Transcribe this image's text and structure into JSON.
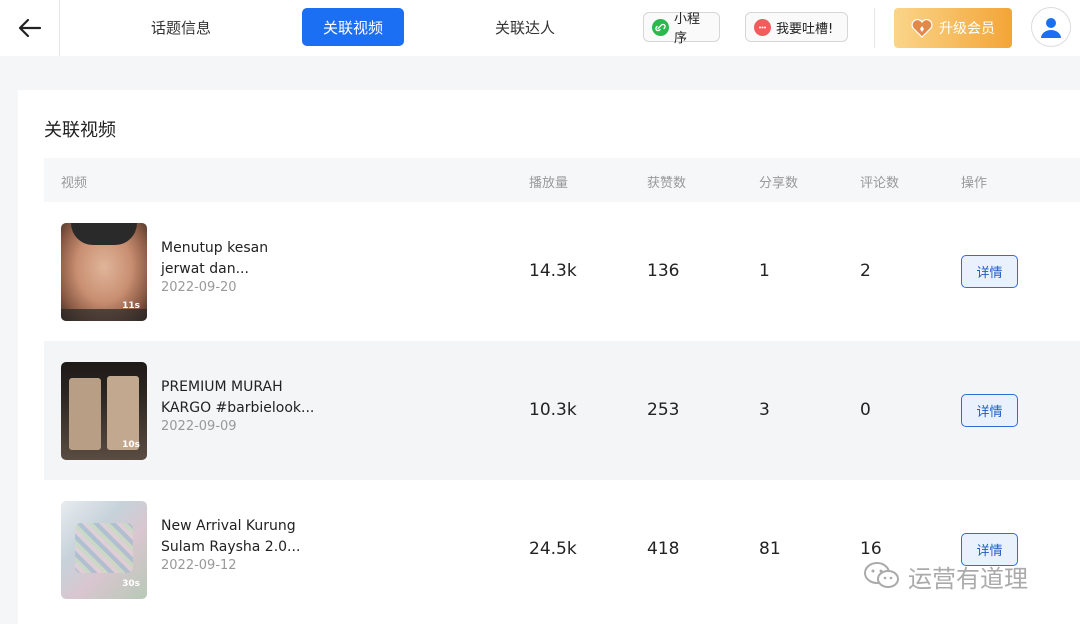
{
  "header": {
    "tabs": [
      {
        "label": "话题信息",
        "active": false
      },
      {
        "label": "关联视频",
        "active": true
      },
      {
        "label": "关联达人",
        "active": false
      }
    ],
    "mini_program_label": "小程序",
    "feedback_label": "我要吐槽!",
    "upgrade_label": "升级会员"
  },
  "section": {
    "title": "关联视频",
    "columns": {
      "video": "视频",
      "plays": "播放量",
      "likes": "获赞数",
      "shares": "分享数",
      "comments": "评论数",
      "action": "操作"
    }
  },
  "rows": [
    {
      "title_line1": "Menutup kesan",
      "title_line2": "jerwat dan...",
      "date": "2022-09-20",
      "duration": "11s",
      "plays": "14.3k",
      "likes": "136",
      "shares": "1",
      "comments": "2",
      "action": "详情"
    },
    {
      "title_line1": "PREMIUM MURAH",
      "title_line2": "KARGO #barbielook...",
      "date": "2022-09-09",
      "duration": "10s",
      "plays": "10.3k",
      "likes": "253",
      "shares": "3",
      "comments": "0",
      "action": "详情"
    },
    {
      "title_line1": "New Arrival Kurung",
      "title_line2": "Sulam Raysha 2.0...",
      "date": "2022-09-12",
      "duration": "30s",
      "plays": "24.5k",
      "likes": "418",
      "shares": "81",
      "comments": "16",
      "action": "详情"
    }
  ],
  "watermark": "运营有道理",
  "colors": {
    "accent": "#1a6ff2",
    "vip_start": "#fbd58a",
    "vip_end": "#f3a537",
    "mini_icon": "#2db84d",
    "feedback_icon": "#f25c5c"
  },
  "icons": [
    "back-arrow-icon",
    "link-icon",
    "chat-icon",
    "heart-icon",
    "user-icon",
    "wechat-icon"
  ]
}
